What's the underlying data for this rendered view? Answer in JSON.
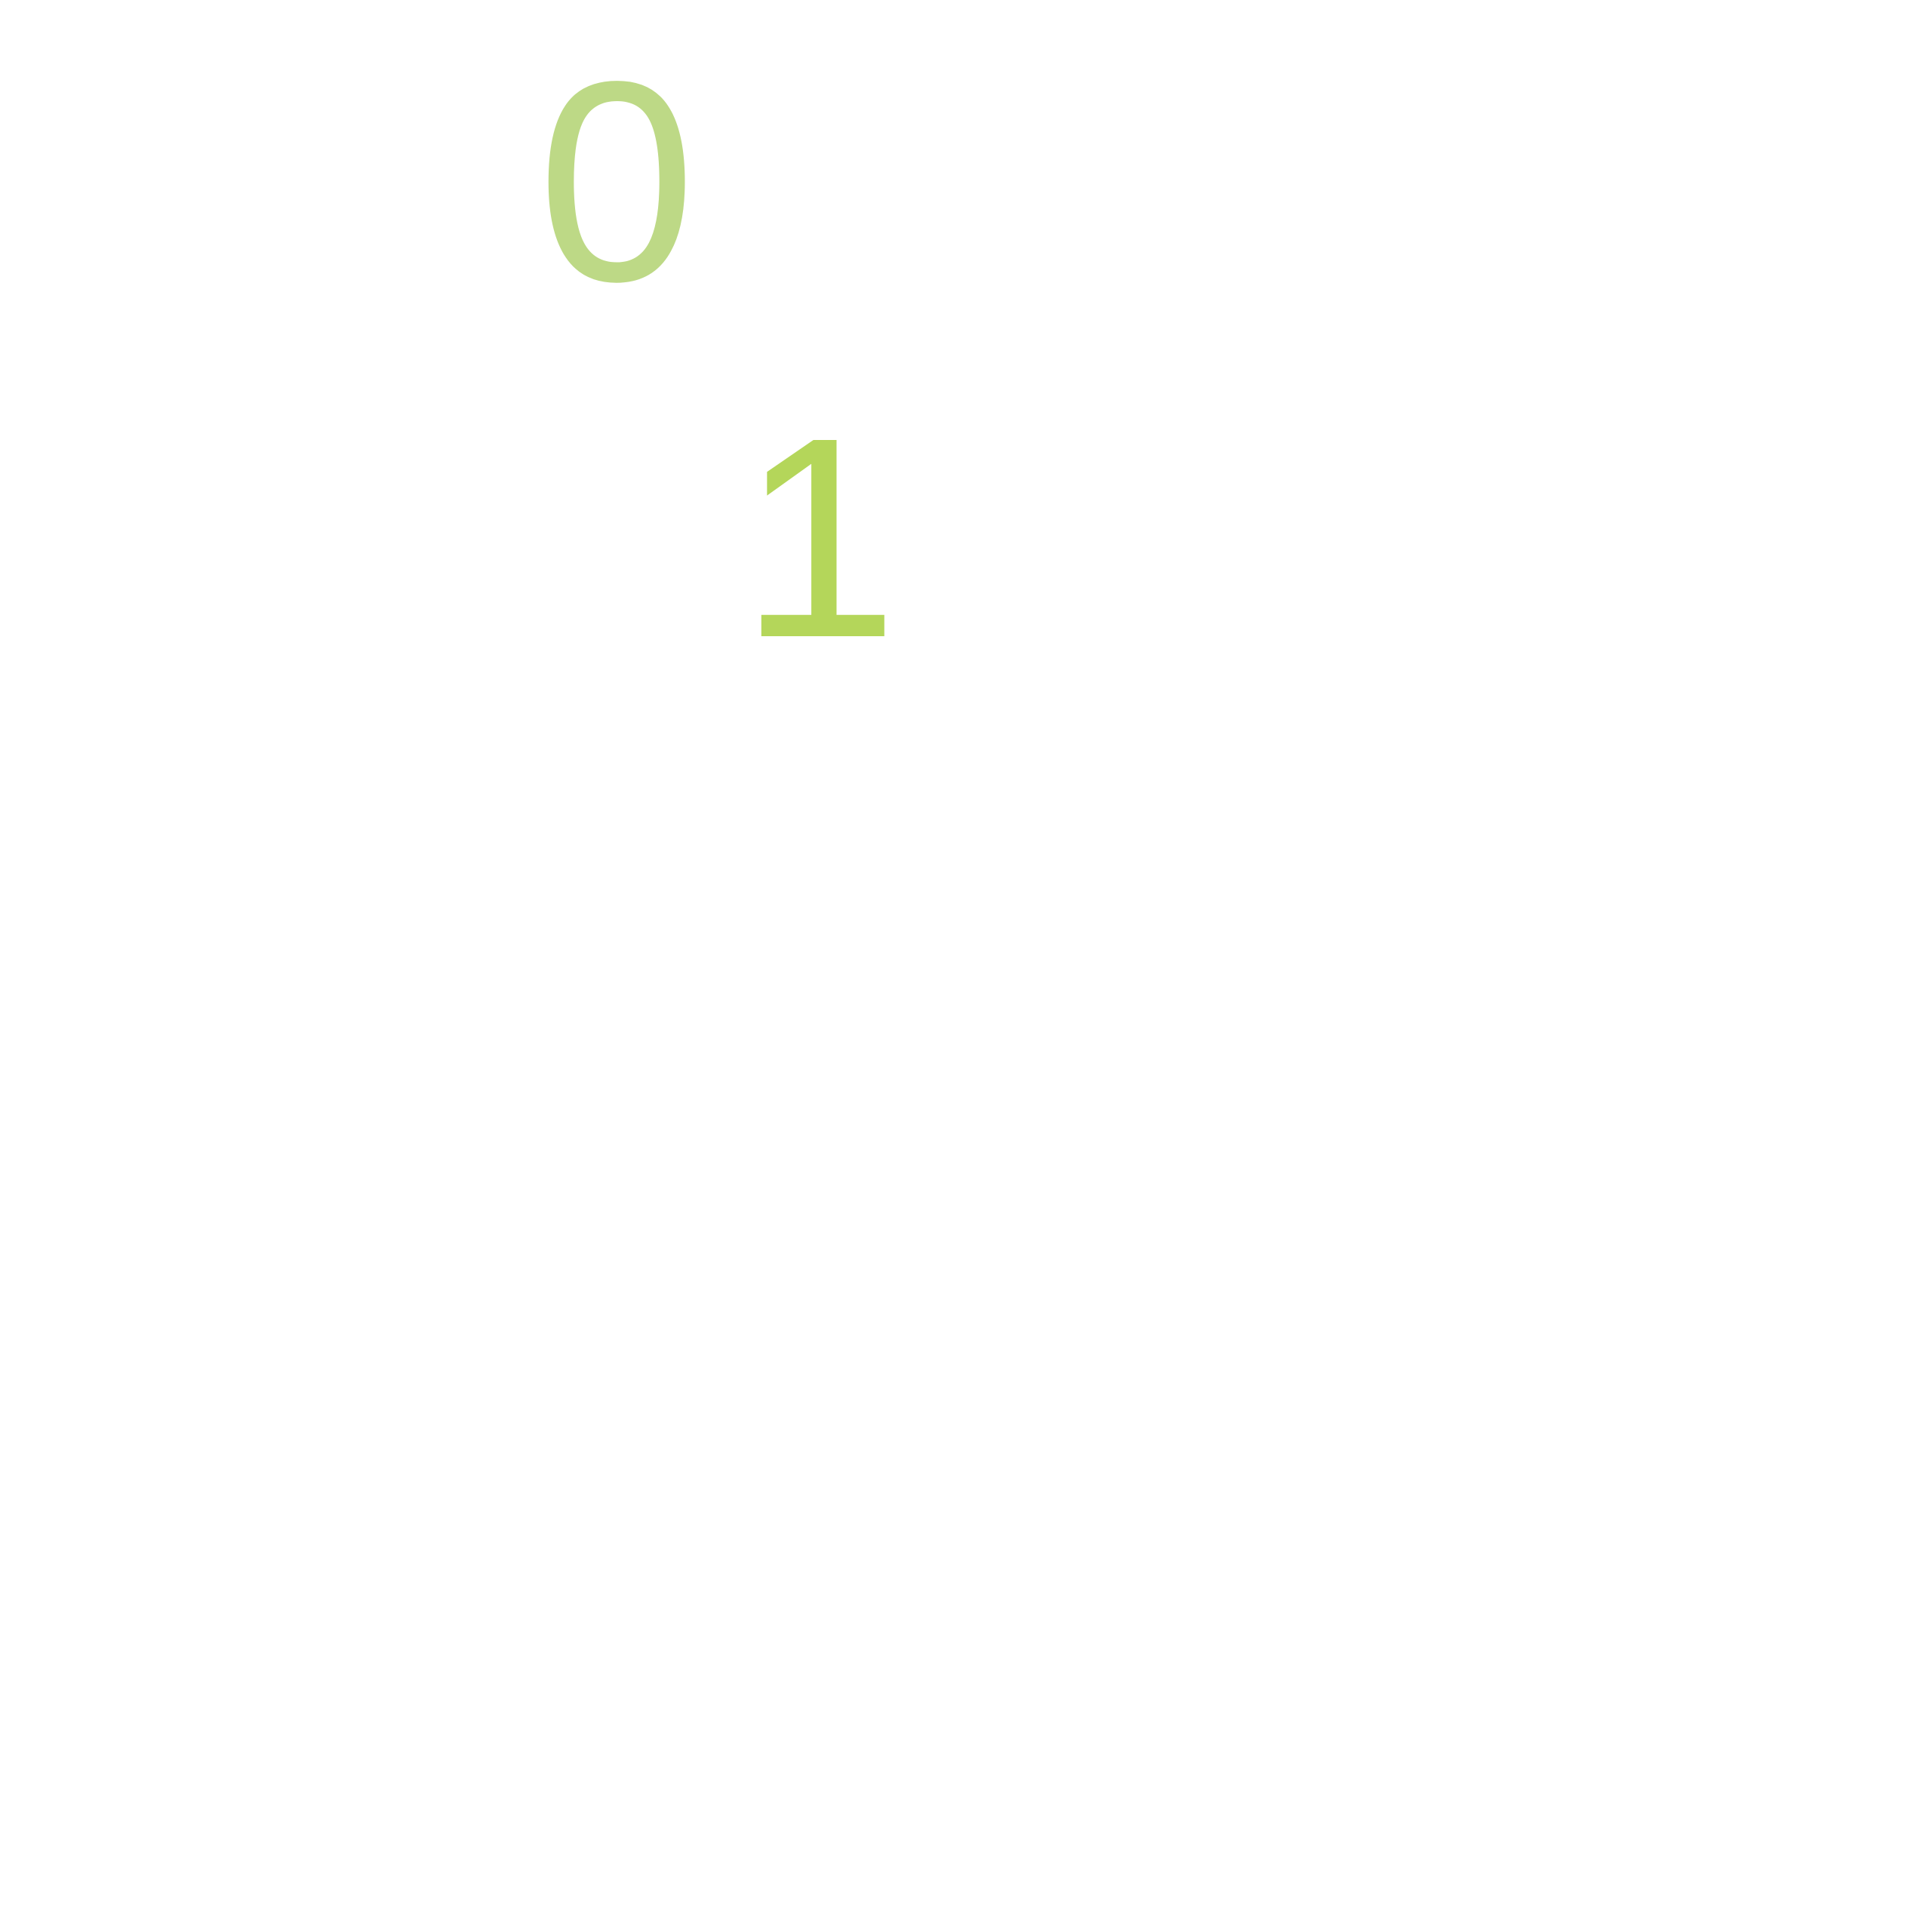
{
  "digits": {
    "first": {
      "text": "0",
      "color": "#bdd986"
    },
    "second": {
      "text": "1",
      "color": "#b4d65a"
    }
  }
}
